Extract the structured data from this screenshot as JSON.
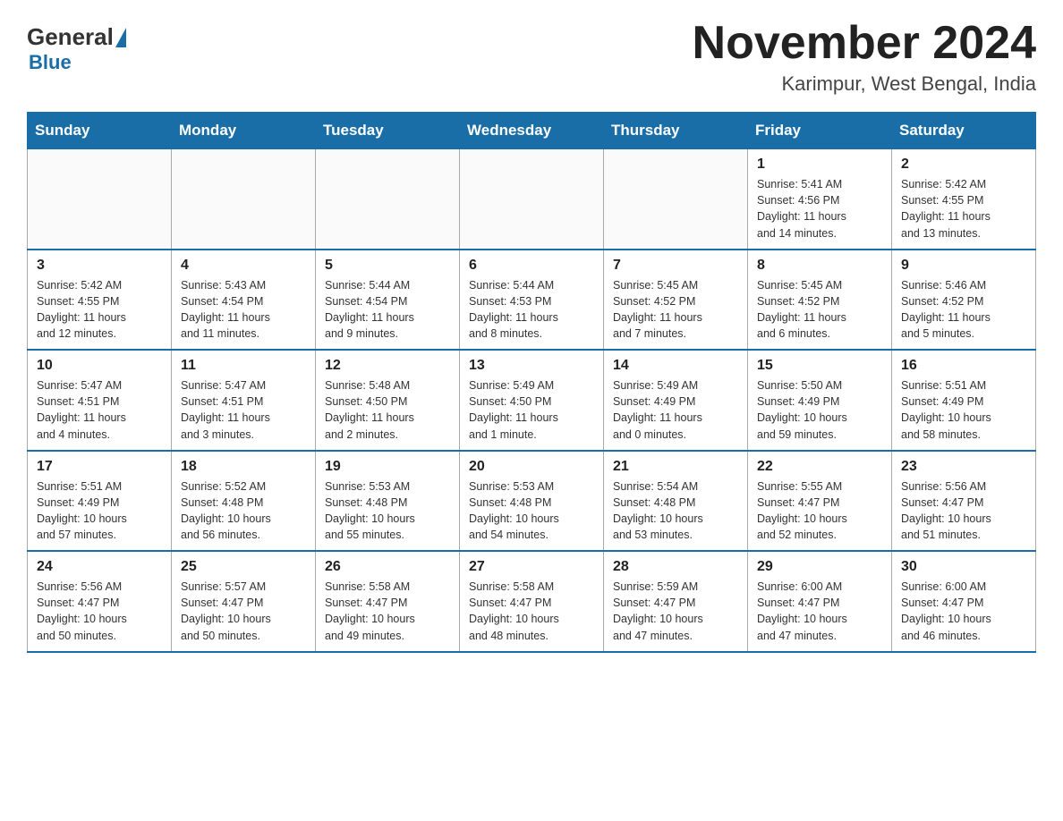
{
  "header": {
    "logo_general": "General",
    "logo_blue": "Blue",
    "month_title": "November 2024",
    "location": "Karimpur, West Bengal, India"
  },
  "weekdays": [
    "Sunday",
    "Monday",
    "Tuesday",
    "Wednesday",
    "Thursday",
    "Friday",
    "Saturday"
  ],
  "weeks": [
    [
      {
        "day": "",
        "info": ""
      },
      {
        "day": "",
        "info": ""
      },
      {
        "day": "",
        "info": ""
      },
      {
        "day": "",
        "info": ""
      },
      {
        "day": "",
        "info": ""
      },
      {
        "day": "1",
        "info": "Sunrise: 5:41 AM\nSunset: 4:56 PM\nDaylight: 11 hours\nand 14 minutes."
      },
      {
        "day": "2",
        "info": "Sunrise: 5:42 AM\nSunset: 4:55 PM\nDaylight: 11 hours\nand 13 minutes."
      }
    ],
    [
      {
        "day": "3",
        "info": "Sunrise: 5:42 AM\nSunset: 4:55 PM\nDaylight: 11 hours\nand 12 minutes."
      },
      {
        "day": "4",
        "info": "Sunrise: 5:43 AM\nSunset: 4:54 PM\nDaylight: 11 hours\nand 11 minutes."
      },
      {
        "day": "5",
        "info": "Sunrise: 5:44 AM\nSunset: 4:54 PM\nDaylight: 11 hours\nand 9 minutes."
      },
      {
        "day": "6",
        "info": "Sunrise: 5:44 AM\nSunset: 4:53 PM\nDaylight: 11 hours\nand 8 minutes."
      },
      {
        "day": "7",
        "info": "Sunrise: 5:45 AM\nSunset: 4:52 PM\nDaylight: 11 hours\nand 7 minutes."
      },
      {
        "day": "8",
        "info": "Sunrise: 5:45 AM\nSunset: 4:52 PM\nDaylight: 11 hours\nand 6 minutes."
      },
      {
        "day": "9",
        "info": "Sunrise: 5:46 AM\nSunset: 4:52 PM\nDaylight: 11 hours\nand 5 minutes."
      }
    ],
    [
      {
        "day": "10",
        "info": "Sunrise: 5:47 AM\nSunset: 4:51 PM\nDaylight: 11 hours\nand 4 minutes."
      },
      {
        "day": "11",
        "info": "Sunrise: 5:47 AM\nSunset: 4:51 PM\nDaylight: 11 hours\nand 3 minutes."
      },
      {
        "day": "12",
        "info": "Sunrise: 5:48 AM\nSunset: 4:50 PM\nDaylight: 11 hours\nand 2 minutes."
      },
      {
        "day": "13",
        "info": "Sunrise: 5:49 AM\nSunset: 4:50 PM\nDaylight: 11 hours\nand 1 minute."
      },
      {
        "day": "14",
        "info": "Sunrise: 5:49 AM\nSunset: 4:49 PM\nDaylight: 11 hours\nand 0 minutes."
      },
      {
        "day": "15",
        "info": "Sunrise: 5:50 AM\nSunset: 4:49 PM\nDaylight: 10 hours\nand 59 minutes."
      },
      {
        "day": "16",
        "info": "Sunrise: 5:51 AM\nSunset: 4:49 PM\nDaylight: 10 hours\nand 58 minutes."
      }
    ],
    [
      {
        "day": "17",
        "info": "Sunrise: 5:51 AM\nSunset: 4:49 PM\nDaylight: 10 hours\nand 57 minutes."
      },
      {
        "day": "18",
        "info": "Sunrise: 5:52 AM\nSunset: 4:48 PM\nDaylight: 10 hours\nand 56 minutes."
      },
      {
        "day": "19",
        "info": "Sunrise: 5:53 AM\nSunset: 4:48 PM\nDaylight: 10 hours\nand 55 minutes."
      },
      {
        "day": "20",
        "info": "Sunrise: 5:53 AM\nSunset: 4:48 PM\nDaylight: 10 hours\nand 54 minutes."
      },
      {
        "day": "21",
        "info": "Sunrise: 5:54 AM\nSunset: 4:48 PM\nDaylight: 10 hours\nand 53 minutes."
      },
      {
        "day": "22",
        "info": "Sunrise: 5:55 AM\nSunset: 4:47 PM\nDaylight: 10 hours\nand 52 minutes."
      },
      {
        "day": "23",
        "info": "Sunrise: 5:56 AM\nSunset: 4:47 PM\nDaylight: 10 hours\nand 51 minutes."
      }
    ],
    [
      {
        "day": "24",
        "info": "Sunrise: 5:56 AM\nSunset: 4:47 PM\nDaylight: 10 hours\nand 50 minutes."
      },
      {
        "day": "25",
        "info": "Sunrise: 5:57 AM\nSunset: 4:47 PM\nDaylight: 10 hours\nand 50 minutes."
      },
      {
        "day": "26",
        "info": "Sunrise: 5:58 AM\nSunset: 4:47 PM\nDaylight: 10 hours\nand 49 minutes."
      },
      {
        "day": "27",
        "info": "Sunrise: 5:58 AM\nSunset: 4:47 PM\nDaylight: 10 hours\nand 48 minutes."
      },
      {
        "day": "28",
        "info": "Sunrise: 5:59 AM\nSunset: 4:47 PM\nDaylight: 10 hours\nand 47 minutes."
      },
      {
        "day": "29",
        "info": "Sunrise: 6:00 AM\nSunset: 4:47 PM\nDaylight: 10 hours\nand 47 minutes."
      },
      {
        "day": "30",
        "info": "Sunrise: 6:00 AM\nSunset: 4:47 PM\nDaylight: 10 hours\nand 46 minutes."
      }
    ]
  ]
}
